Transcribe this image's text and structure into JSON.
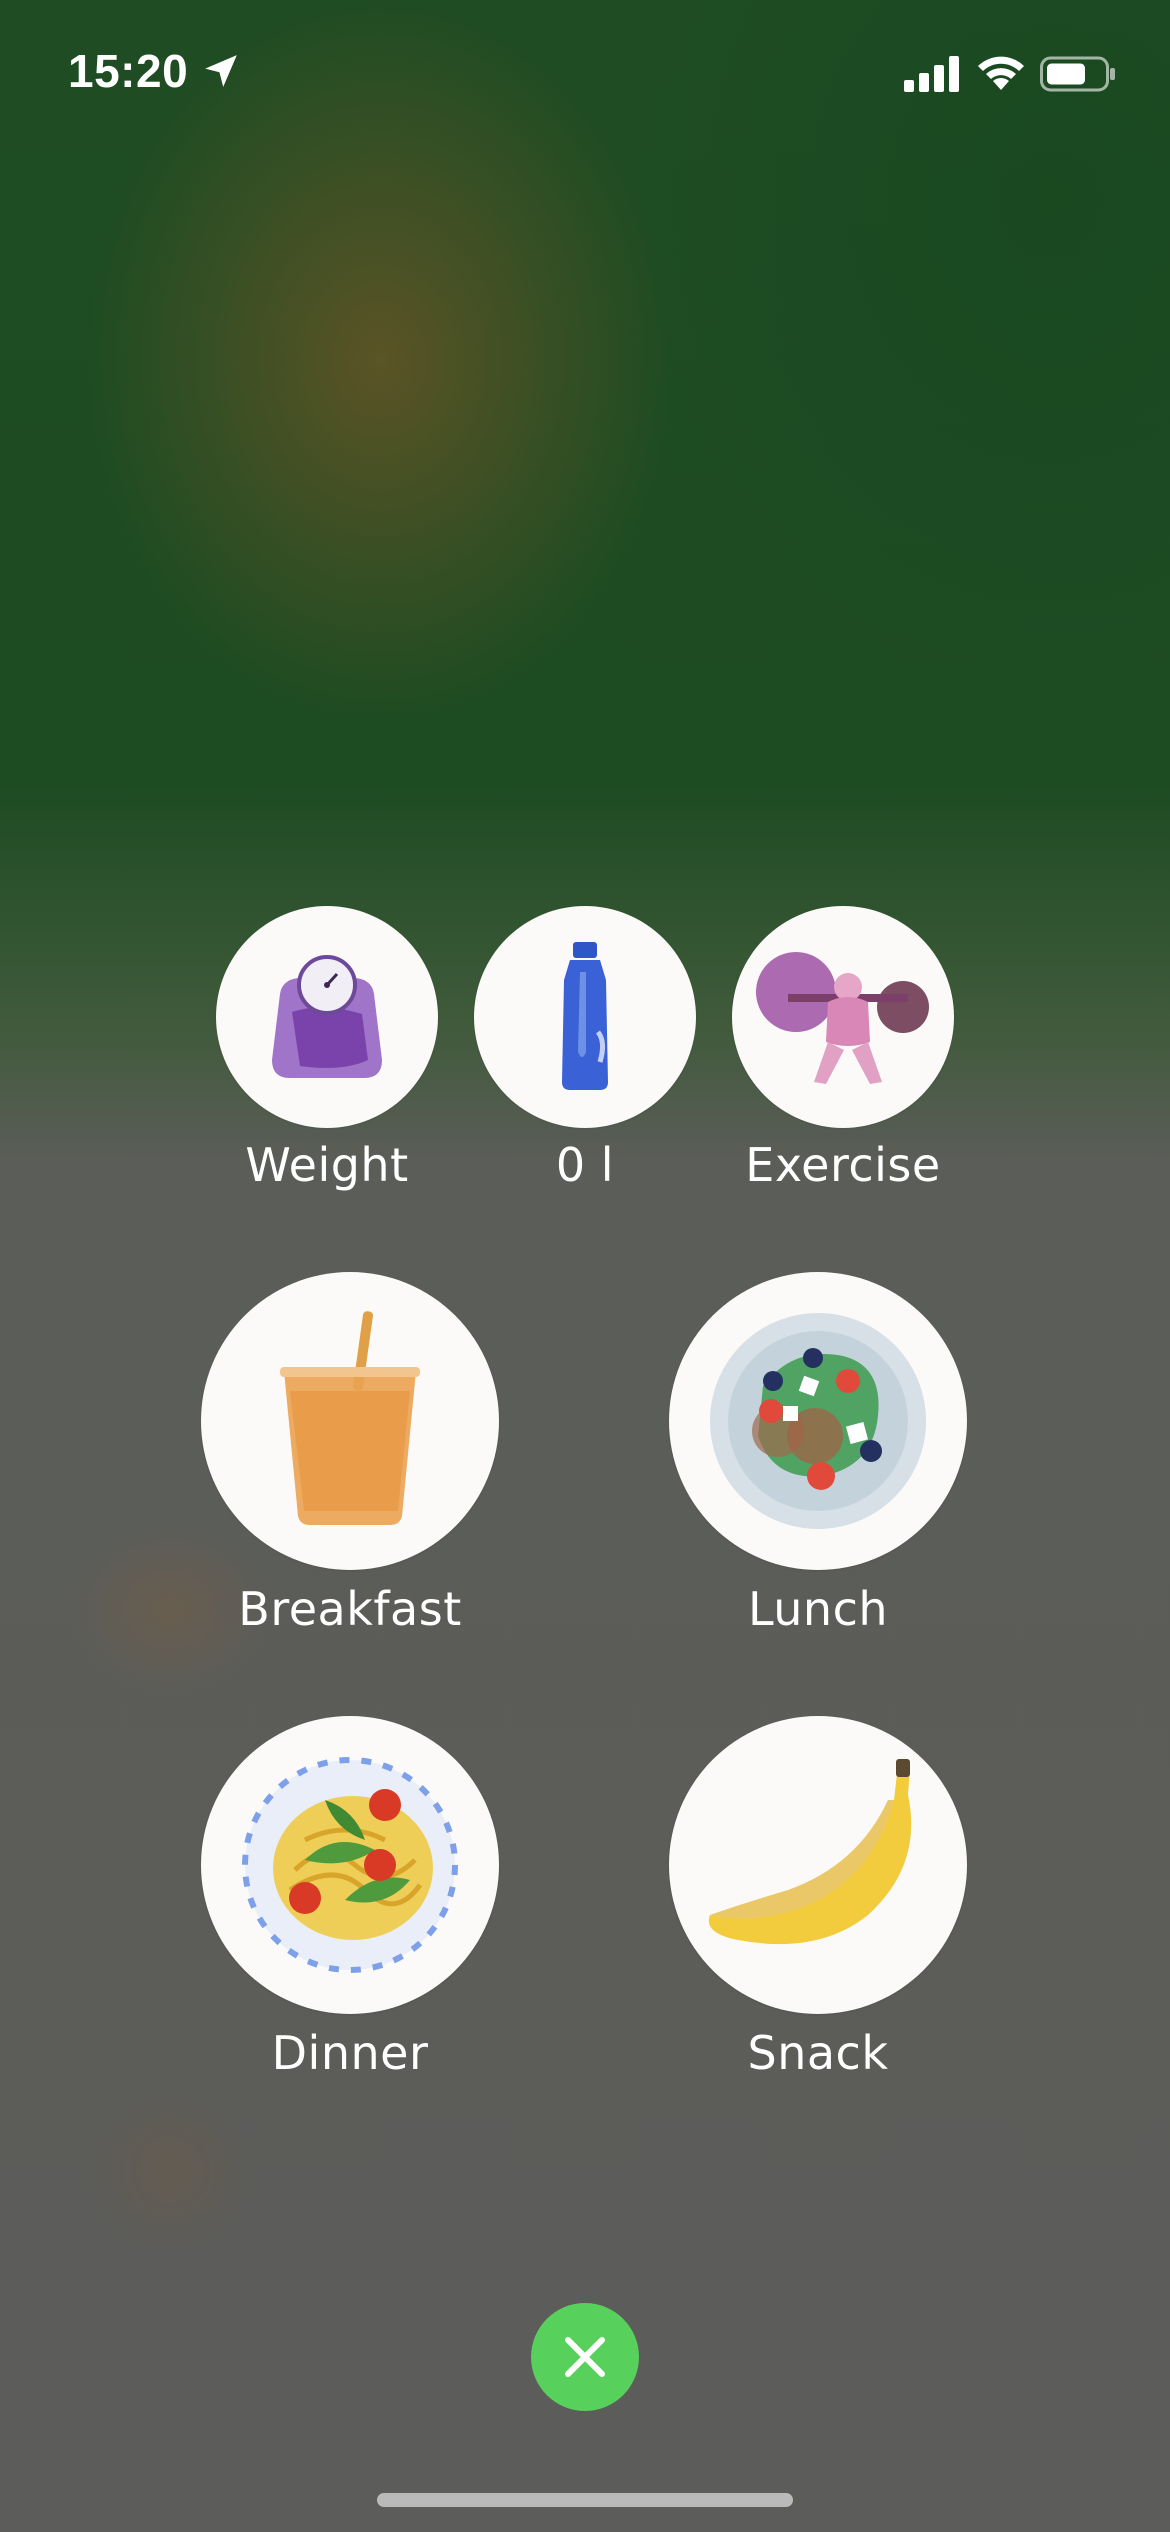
{
  "status_bar": {
    "time": "15:20",
    "icons": [
      "location-arrow-icon",
      "cellular-signal-icon",
      "wifi-icon",
      "battery-icon"
    ]
  },
  "quick_actions": {
    "weight": {
      "label": "Weight",
      "icon": "bathroom-scale-icon"
    },
    "water": {
      "label": "0 l",
      "icon": "water-bottle-icon"
    },
    "exercise": {
      "label": "Exercise",
      "icon": "weightlifter-icon"
    },
    "breakfast": {
      "label": "Breakfast",
      "icon": "juice-cup-icon"
    },
    "lunch": {
      "label": "Lunch",
      "icon": "salad-bowl-icon"
    },
    "dinner": {
      "label": "Dinner",
      "icon": "pasta-plate-icon"
    },
    "snack": {
      "label": "Snack",
      "icon": "banana-icon"
    }
  },
  "close_button": {
    "icon": "close-icon",
    "color": "#57d15b"
  },
  "colors": {
    "background_top": "#1f4c23",
    "background_bottom": "#5c5c5a",
    "circle": "#fbfaf8"
  }
}
